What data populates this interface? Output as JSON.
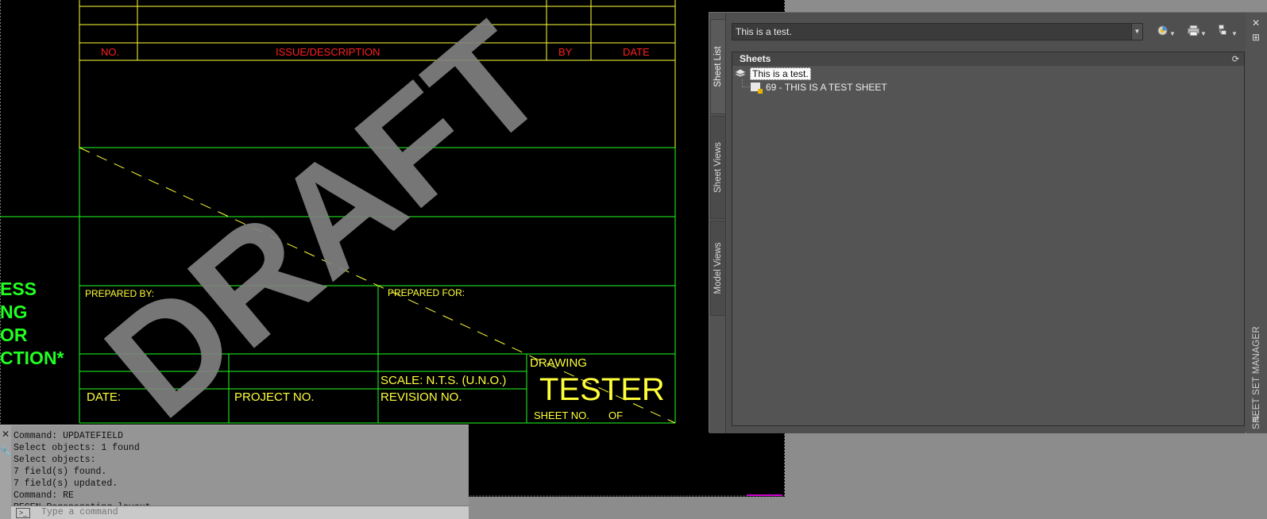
{
  "drawing": {
    "rev_table_headers": {
      "no": "NO.",
      "description": "ISSUE/DESCRIPTION",
      "by": "BY",
      "date": "DATE"
    },
    "watermark": "DRAFT",
    "note_lines": [
      "ESS",
      "NG",
      "OR",
      "CTION*"
    ],
    "prepared_by_label": "PREPARED BY:",
    "prepared_for_label": "PREPARED FOR:",
    "scale_label": "SCALE: N.T.S. (U.N.O.)",
    "date_label": "DATE:",
    "project_no_label": "PROJECT NO.",
    "revision_no_label": "REVISION NO.",
    "drawing_label": "DRAWING",
    "drawing_title": "TESTER",
    "sheet_no_label": "SHEET NO.",
    "of_label": "OF",
    "colors": {
      "background": "#000000",
      "lines_yellow": "#ffff3a",
      "lines_green": "#21ff21",
      "text_red": "#ff1f1f",
      "watermark": "#808080"
    }
  },
  "command_line": {
    "side_icons": [
      "close-icon",
      "settings-icon"
    ],
    "side_glyphs": [
      "✕",
      "🔧"
    ],
    "history": "Command: UPDATEFIELD\nSelect objects: 1 found\nSelect objects:\n7 field(s) found.\n7 field(s) updated.\nCommand: RE\nREGEN Regenerating layout.",
    "placeholder": "Type a command",
    "prompt_icon": ">_"
  },
  "sheet_set_manager": {
    "title": "SHEET SET MANAGER",
    "tabs": [
      "Sheet List",
      "Sheet Views",
      "Model Views"
    ],
    "active_tab": "Sheet List",
    "sheet_set_selector": "This is a test.",
    "toolbar_icons": [
      "publish-status-icon",
      "publish-icon",
      "sheet-selections-icon"
    ],
    "panel_header": "Sheets",
    "tree": {
      "root": "This is a test.",
      "sheets": [
        "69 - THIS IS A TEST SHEET"
      ]
    }
  }
}
